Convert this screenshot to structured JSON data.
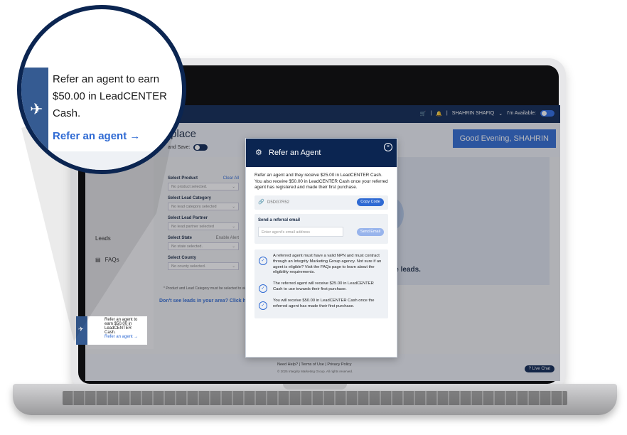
{
  "topbar": {
    "cart_icon": "cart-icon",
    "bell_icon": "bell-icon",
    "user_name": "SHAHRIN SHAFIQ",
    "available_label": "I'm Available:"
  },
  "page": {
    "title": "tplace",
    "autosave_label": "and Save:",
    "greeting": "Good Evening, SHAHRIN"
  },
  "sidebar": {
    "leads_label": "Leads",
    "faqs_label": "FAQs"
  },
  "filters": {
    "clear_all": "Clear All",
    "enable_alert": "Enable Alert",
    "items": [
      {
        "label": "Select Product",
        "value": "No product selected."
      },
      {
        "label": "Select Lead Category",
        "value": "No lead category selected"
      },
      {
        "label": "Select Lead Partner",
        "value": "No lead partner selected"
      },
      {
        "label": "Select State",
        "value": "No state selected."
      },
      {
        "label": "Select County",
        "value": "No county selected."
      }
    ],
    "note": "* Product and Lead Category must be selected to view available",
    "dont_see": "Don't see leads in your area? Click here to su"
  },
  "map": {
    "message": "Category to purchase leads."
  },
  "footer": {
    "links": "Need Help?  |  Terms of Use  |  Privacy Policy",
    "copyright": "© 2025 Integrity Marketing Group. All rights reserved.",
    "live_chat": "Live Chat"
  },
  "refer_card": {
    "text": "Refer an agent to earn $50.00 in LeadCENTER Cash.",
    "link": "Refer an agent →"
  },
  "modal": {
    "title": "Refer an Agent",
    "intro": "Refer an agent and they receive $25.00 in LeadCENTER Cash. You also receive $50.00 in LeadCENTER Cash once your referred agent has registered and made their first purchase.",
    "code": "D5DG7R52",
    "copy_button": "Copy Code",
    "email_label": "Send a referral email",
    "email_placeholder": "Enter agent's email address",
    "send_button": "Send Email",
    "info": [
      "A referred agent must have a valid NPN and must contract through an Integrity Marketing Group agency.  Not sure if an agent is eligible? Visit the FAQs page to learn about the eligibility requirements.",
      "The referred agent will receive $25.00 in LeadCENTER Cash to use towards their first purchase.",
      "You will receive $50.00 in LeadCENTER Cash once the referred agent has made their first purchase."
    ]
  },
  "zoom": {
    "text": "Refer an agent to earn $50.00 in LeadCENTER Cash.",
    "link": "Refer an agent →"
  },
  "colors": {
    "navy": "#0b2551",
    "accent_blue": "#2f6ad3",
    "sidebar_blue": "#355b92"
  }
}
